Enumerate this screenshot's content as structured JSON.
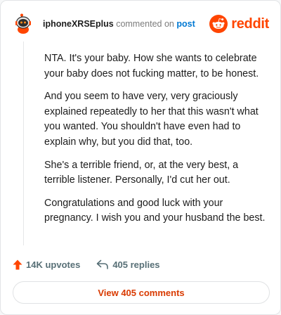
{
  "header": {
    "username": "iphoneXRSEplus",
    "verb": "commented on",
    "target": "post",
    "brand": "reddit",
    "avatar_icon": "snoo-astronaut-avatar",
    "brand_icon": "reddit-snoo-icon"
  },
  "comment": {
    "paragraphs": [
      "NTA. It's your baby. How she wants to celebrate your baby does not fucking matter, to be honest.",
      "And you seem to have very, very graciously explained repeatedly to her that this wasn't what you wanted. You shouldn't have even had to explain why, but you did that, too.",
      "She's a terrible friend, or, at the very best, a terrible listener. Personally, I'd cut her out.",
      "Congratulations and good luck with your pregnancy. I wish you and your husband the best."
    ]
  },
  "actions": {
    "upvotes": "14K upvotes",
    "replies": "405 replies",
    "view_comments": "View 405 comments"
  },
  "colors": {
    "brand": "#ff4500",
    "link": "#0079d3",
    "view_button_text": "#d93a00"
  }
}
